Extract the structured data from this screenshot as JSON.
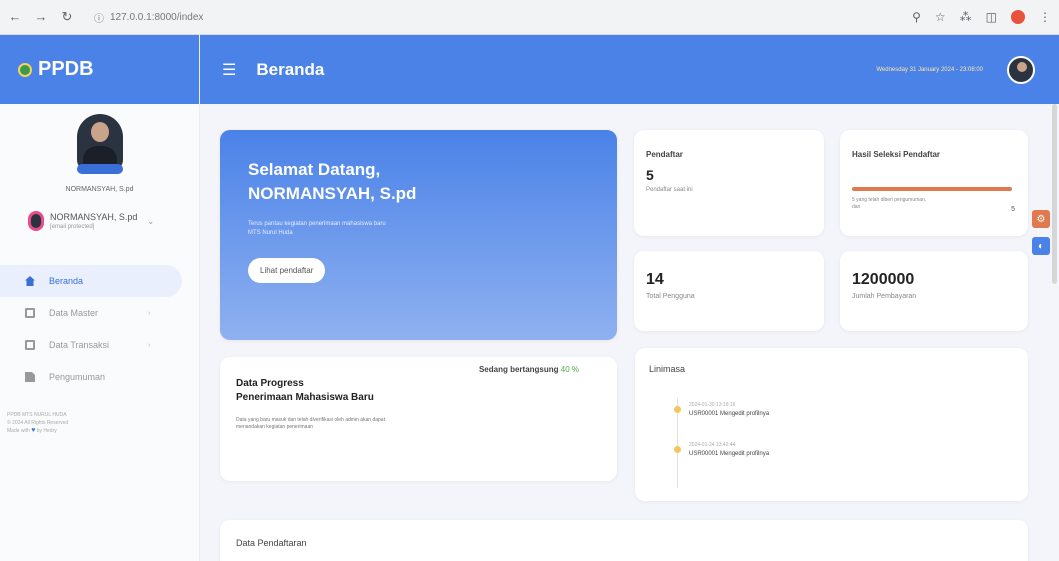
{
  "browser": {
    "url": "127.0.0.1:8000/index",
    "nav_icons": [
      "back-icon",
      "forward-icon",
      "reload-icon"
    ],
    "toolbar_icons": [
      "zoom-icon",
      "star-icon",
      "extension-icon",
      "sidebar-icon"
    ]
  },
  "brand": {
    "name": "PPDB"
  },
  "sidebar": {
    "profile_name": "NORMANSYAH, S.pd",
    "user_name": "NORMANSYAH, S.pd",
    "user_email": "[email protected]",
    "menu": [
      {
        "label": "Beranda",
        "active": true,
        "icon": "home-icon"
      },
      {
        "label": "Data Master",
        "active": false,
        "icon": "database-icon"
      },
      {
        "label": "Data Transaksi",
        "active": false,
        "icon": "transaction-icon"
      },
      {
        "label": "Pengumuman",
        "active": false,
        "icon": "announcement-icon"
      }
    ],
    "footer_line1": "PPDB MTS NURUL HUDA",
    "footer_line2": "© 2024 All Rights Reserved",
    "footer_line3": "Made with",
    "footer_line4": "by Hedry"
  },
  "header": {
    "title": "Beranda",
    "datetime": "Wednesday 31 January 2024 - 23:08:00"
  },
  "welcome": {
    "greeting": "Selamat Datang,",
    "name": "NORMANSYAH, S.pd",
    "description": "Terus pantau kegiatan penerimaan mahasiswa baru MTS Nurul Huda",
    "button": "Lihat pendaftar"
  },
  "stats": {
    "pendaftar": {
      "label": "Pendaftar",
      "value": "5",
      "sub": "Pendaftar saat ini"
    },
    "seleksi": {
      "label": "Hasil Seleksi Pendaftar",
      "note": "5 yang telah diberi pengumuman, dari",
      "count": "5",
      "progress": 1.0
    },
    "pengguna": {
      "value": "14",
      "sub": "Total Pengguna"
    },
    "pembayaran": {
      "value": "1200000",
      "sub": "Jumlah Pembayaran"
    }
  },
  "progress": {
    "status": "Sedang bertangsung",
    "percent": "40 %",
    "title_line1": "Data Progress",
    "title_line2": "Penerimaan Mahasiswa Baru",
    "description": "Data yang baru masuk dan telah diverifikasi oleh admin akan dapat menandakan kegiatan penerimaan"
  },
  "timeline": {
    "title": "Linimasa",
    "items": [
      {
        "time": "2024-01-30 13:18:16",
        "event": "USR00001 Mengedit profilnya"
      },
      {
        "time": "2024-01-24 13:42:44",
        "event": "USR00001 Mengedit profilnya"
      }
    ]
  },
  "pendaftaran": {
    "title": "Data Pendaftaran"
  },
  "colors": {
    "primary": "#4a82e8",
    "accent": "#e07a4e",
    "success": "#4caf50"
  }
}
